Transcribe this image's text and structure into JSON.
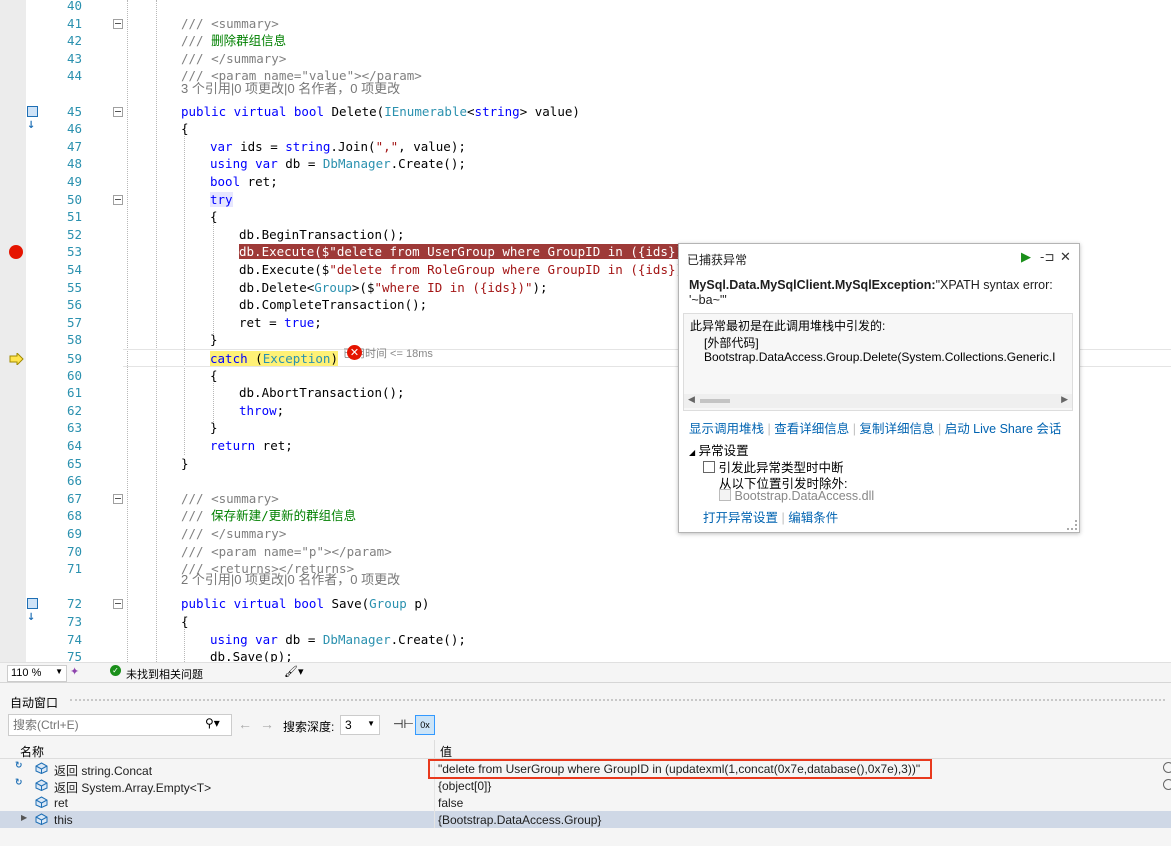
{
  "editor": {
    "lines": [
      {
        "num": "40",
        "html": ""
      },
      {
        "num": "41",
        "html": "<span class=\"cmg\">/// &lt;summary&gt;</span>",
        "indent": 55,
        "fold": true
      },
      {
        "num": "42",
        "html": "<span class=\"cmg\">/// </span><span class=\"cm\">删除群组信息</span>",
        "indent": 55
      },
      {
        "num": "43",
        "html": "<span class=\"cmg\">/// &lt;/summary&gt;</span>",
        "indent": 55
      },
      {
        "num": "44",
        "html": "<span class=\"cmg\">/// &lt;param name=\"value\"&gt;&lt;/param&gt;</span>",
        "indent": 55
      },
      {
        "num": "45",
        "html": "<span class=\"kw\">public virtual bool</span> Delete(<span class=\"ty\">IEnumerable</span>&lt;<span class=\"kw\">string</span>&gt; value)",
        "indent": 55,
        "fold": true,
        "ref": true
      },
      {
        "num": "46",
        "html": "{",
        "indent": 55
      },
      {
        "num": "47",
        "html": "<span class=\"kw\">var</span> ids = <span class=\"kw\">string</span>.Join(<span class=\"st\">\",\"</span>, value);",
        "indent": 84
      },
      {
        "num": "48",
        "html": "<span class=\"kw\">using var</span> db = <span class=\"ty\">DbManager</span>.Create();",
        "indent": 84
      },
      {
        "num": "49",
        "html": "<span class=\"kw\">bool</span> ret;",
        "indent": 84
      },
      {
        "num": "50",
        "html": "<span class=\"kw\" style=\"background:#e6e6ff\">try</span>",
        "indent": 84,
        "fold": true
      },
      {
        "num": "51",
        "html": "{",
        "indent": 84
      },
      {
        "num": "52",
        "html": "db.BeginTransaction();",
        "indent": 113
      },
      {
        "num": "53",
        "html": "<span class=\"breakhl\">db.Execute($\"delete from UserGroup where GroupID in ({ids})\")</span>",
        "indent": 113,
        "bp": true
      },
      {
        "num": "54",
        "html": "db.Execute($<span class=\"st\">\"delete from RoleGroup where GroupID in ({ids})\"</span>)",
        "indent": 113
      },
      {
        "num": "55",
        "html": "db.Delete&lt;<span class=\"ty\">Group</span>&gt;($<span class=\"st\">\"where ID in ({ids})\"</span>);",
        "indent": 113
      },
      {
        "num": "56",
        "html": "db.CompleteTransaction();",
        "indent": 113
      },
      {
        "num": "57",
        "html": "ret = <span class=\"kw\">true</span>;",
        "indent": 113
      },
      {
        "num": "58",
        "html": "}",
        "indent": 84
      },
      {
        "num": "59",
        "html": "<span class=\"cur\"><span class=\"kw\">catch</span> (<span class=\"ty\">Exception</span>)</span>",
        "indent": 84,
        "current": true
      },
      {
        "num": "60",
        "html": "{",
        "indent": 84
      },
      {
        "num": "61",
        "html": "db.AbortTransaction();",
        "indent": 113
      },
      {
        "num": "62",
        "html": "<span class=\"kw\">throw</span>;",
        "indent": 113
      },
      {
        "num": "63",
        "html": "}",
        "indent": 84
      },
      {
        "num": "64",
        "html": "<span class=\"kw\">return</span> ret;",
        "indent": 84
      },
      {
        "num": "65",
        "html": "}",
        "indent": 55
      },
      {
        "num": "66",
        "html": ""
      },
      {
        "num": "67",
        "html": "<span class=\"cmg\">/// &lt;summary&gt;</span>",
        "indent": 55,
        "fold": true
      },
      {
        "num": "68",
        "html": "<span class=\"cmg\">/// </span><span class=\"cm\">保存新建/更新的群组信息</span>",
        "indent": 55
      },
      {
        "num": "69",
        "html": "<span class=\"cmg\">/// &lt;/summary&gt;</span>",
        "indent": 55
      },
      {
        "num": "70",
        "html": "<span class=\"cmg\">/// &lt;param name=\"p\"&gt;&lt;/param&gt;</span>",
        "indent": 55
      },
      {
        "num": "71",
        "html": "<span class=\"cmg\">/// &lt;returns&gt;&lt;/returns&gt;</span>",
        "indent": 55
      },
      {
        "num": "72",
        "html": "<span class=\"kw\">public virtual bool</span> Save(<span class=\"ty\">Group</span> p)",
        "indent": 55,
        "fold": true,
        "ref": true
      },
      {
        "num": "73",
        "html": "{",
        "indent": 55
      },
      {
        "num": "74",
        "html": "<span class=\"kw\">using var</span> db = <span class=\"ty\">DbManager</span>.Create();",
        "indent": 84
      },
      {
        "num": "75",
        "html": "db.Save(p);",
        "indent": 84
      }
    ],
    "codelens_45": "3 个引用|0 项更改|0 名作者，0 项更改",
    "codelens_72": "2 个引用|0 项更改|0 名作者，0 项更改",
    "perf_tip": "已用时间 <= 18ms"
  },
  "exception": {
    "header": "已捕获异常",
    "type": "MySql.Data.MySqlClient.MySqlException:",
    "message": "\"XPATH syntax error: '~ba~'\"",
    "stack_intro": "此异常最初是在此调用堆栈中引发的:",
    "stack_ext": "[外部代码]",
    "stack_frame": "Bootstrap.DataAccess.Group.Delete(System.Collections.Generic.I",
    "links": [
      "显示调用堆栈",
      "查看详细信息",
      "复制详细信息",
      "启动 Live Share 会话"
    ],
    "settings_title": "异常设置",
    "break_check": "引发此异常类型时中断",
    "except_label": "从以下位置引发时除外:",
    "except_dll": "Bootstrap.DataAccess.dll",
    "open_settings": "打开异常设置",
    "edit_cond": "编辑条件"
  },
  "status": {
    "zoom": "110 %",
    "issues": "未找到相关问题"
  },
  "autos": {
    "title": "自动窗口",
    "search_placeholder": "搜索(Ctrl+E)",
    "depth_label": "搜索深度:",
    "depth_value": "3",
    "col_name": "名称",
    "col_value": "值",
    "rows": [
      {
        "name": "返回 string.Concat",
        "value": "\"delete from UserGroup where GroupID in (updatexml(1,concat(0x7e,database(),0x7e),3))\"",
        "ret": true
      },
      {
        "name": "返回 System.Array.Empty<T>",
        "value": "{object[0]}",
        "ret": true
      },
      {
        "name": "ret",
        "value": "false"
      },
      {
        "name": "this",
        "value": "{Bootstrap.DataAccess.Group}",
        "expand": true,
        "selected": true
      }
    ]
  }
}
